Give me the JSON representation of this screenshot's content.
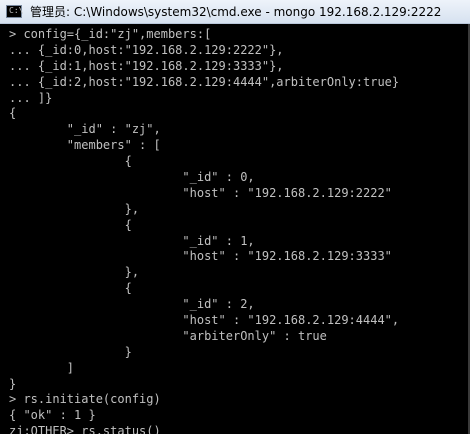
{
  "window": {
    "title": "管理员: C:\\Windows\\system32\\cmd.exe - mongo  192.168.2.129:2222",
    "icon": "cmd-prompt-icon",
    "icon_glyph": "C:\\"
  },
  "console": {
    "text_color": "#c0c0c0",
    "background": "#000000",
    "lines": [
      "> config={_id:\"zj\",members:[",
      "... {_id:0,host:\"192.168.2.129:2222\"},",
      "... {_id:1,host:\"192.168.2.129:3333\"},",
      "... {_id:2,host:\"192.168.2.129:4444\",arbiterOnly:true}",
      "... ]}",
      "{",
      "        \"_id\" : \"zj\",",
      "        \"members\" : [",
      "                {",
      "                        \"_id\" : 0,",
      "                        \"host\" : \"192.168.2.129:2222\"",
      "                },",
      "                {",
      "                        \"_id\" : 1,",
      "                        \"host\" : \"192.168.2.129:3333\"",
      "                },",
      "                {",
      "                        \"_id\" : 2,",
      "                        \"host\" : \"192.168.2.129:4444\",",
      "                        \"arbiterOnly\" : true",
      "                }",
      "        ]",
      "}",
      "> rs.initiate(config)",
      "{ \"ok\" : 1 }",
      "zj:OTHER> rs.status()"
    ]
  }
}
